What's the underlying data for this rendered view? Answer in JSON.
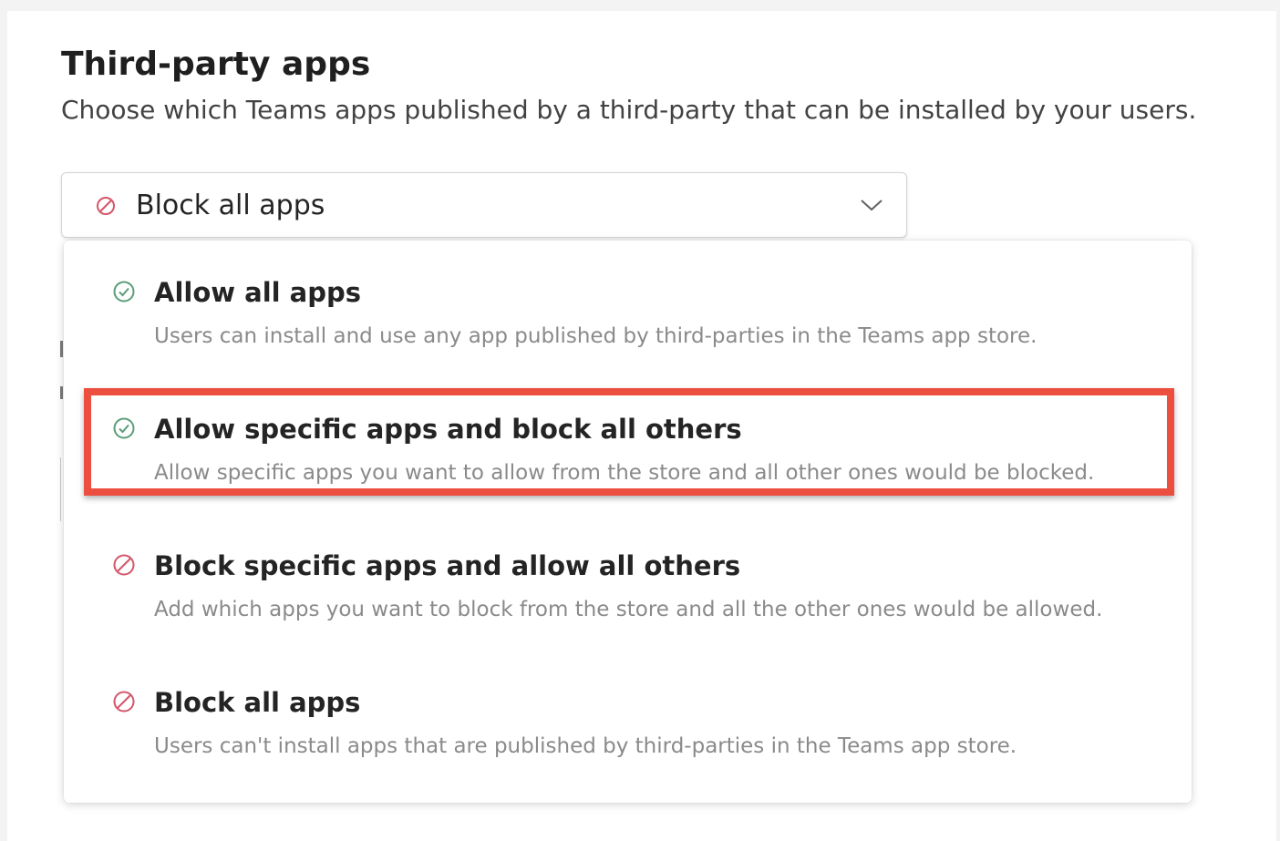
{
  "section": {
    "title": "Third-party apps",
    "subtitle": "Choose which Teams apps published by a third-party that can be installed by your users."
  },
  "dropdown": {
    "selected_label": "Block all apps",
    "selected_icon": "block-icon",
    "chevron_icon": "chevron-down-icon",
    "expanded": true
  },
  "options": [
    {
      "label": "Allow all apps",
      "description": "Users can install and use any app published by third-parties in the Teams app store.",
      "icon": "check-circle-icon",
      "highlighted": false
    },
    {
      "label": "Allow specific apps and block all others",
      "description": "Allow specific apps you want to allow from the store and all other ones would be blocked.",
      "icon": "check-circle-icon",
      "highlighted": true
    },
    {
      "label": "Block specific apps and allow all others",
      "description": "Add which apps you want to block from the store and all the other ones would be allowed.",
      "icon": "block-icon",
      "highlighted": false
    },
    {
      "label": "Block all apps",
      "description": "Users can't install apps that are published by third-parties in the Teams app store.",
      "icon": "block-icon",
      "highlighted": false
    }
  ],
  "colors": {
    "allow_icon": "#5b9e7a",
    "block_icon": "#d4576a",
    "highlight_border": "#ec4f40",
    "description_text": "#8a8a8a"
  }
}
